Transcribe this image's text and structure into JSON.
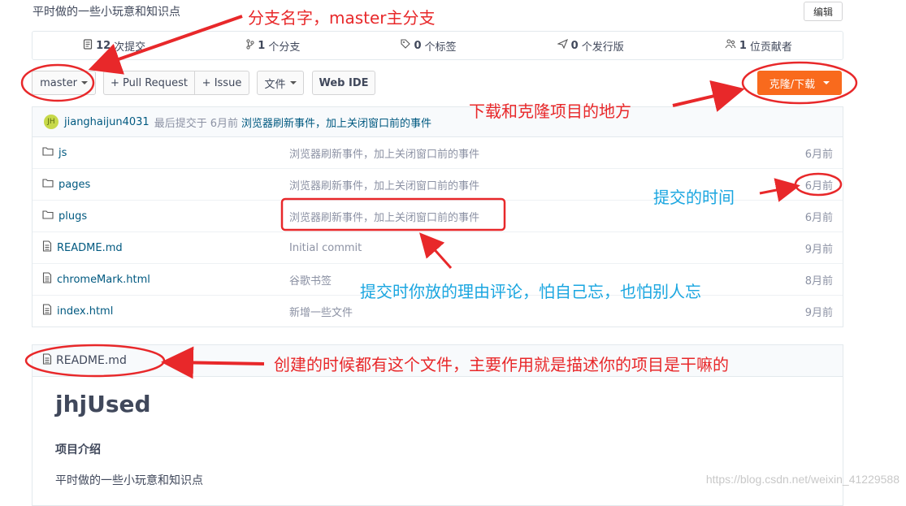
{
  "repo": {
    "description": "平时做的一些小玩意和知识点",
    "edit_label": "编辑"
  },
  "stats": [
    {
      "count": "12",
      "label": "次提交",
      "icon": "commits-icon"
    },
    {
      "count": "1",
      "label": "个分支",
      "icon": "branch-icon"
    },
    {
      "count": "0",
      "label": "个标签",
      "icon": "tag-icon"
    },
    {
      "count": "0",
      "label": "个发行版",
      "icon": "release-icon"
    },
    {
      "count": "1",
      "label": "位贡献者",
      "icon": "contributors-icon"
    }
  ],
  "toolbar": {
    "branch": "master",
    "pull_request": "+ Pull Request",
    "issue": "+ Issue",
    "file": "文件",
    "web_ide": "Web IDE",
    "clone": "克隆/下载"
  },
  "last_commit": {
    "avatar_text": "JH",
    "author": "jianghaijun4031",
    "label": "最后提交于",
    "time": "6月前",
    "message": "浏览器刷新事件，加上关闭窗口前的事件"
  },
  "files": [
    {
      "name": "js",
      "type": "folder",
      "message": "浏览器刷新事件，加上关闭窗口前的事件",
      "time": "6月前"
    },
    {
      "name": "pages",
      "type": "folder",
      "message": "浏览器刷新事件，加上关闭窗口前的事件",
      "time": "6月前"
    },
    {
      "name": "plugs",
      "type": "folder",
      "message": "浏览器刷新事件，加上关闭窗口前的事件",
      "time": "6月前"
    },
    {
      "name": "README.md",
      "type": "file",
      "message": "Initial commit",
      "time": "9月前"
    },
    {
      "name": "chromeMark.html",
      "type": "file",
      "message": "谷歌书签",
      "time": "8月前"
    },
    {
      "name": "index.html",
      "type": "file",
      "message": "新增一些文件",
      "time": "9月前"
    }
  ],
  "readme": {
    "file_name": "README.md",
    "title": "jhjUsed",
    "section": "项目介绍",
    "text": "平时做的一些小玩意和知识点"
  },
  "annotations": {
    "branch_name": "分支名字，master主分支",
    "clone_place": "下载和克隆项目的地方",
    "commit_time": "提交的时间",
    "commit_reason": "提交时你放的理由评论，怕自己忘，也怕别人忘",
    "readme_purpose": "创建的时候都有这个文件，主要作用就是描述你的项目是干嘛的"
  },
  "watermark": "https://blog.csdn.net/weixin_41229588",
  "colors": {
    "clone_button": "#f96a1d",
    "annotation_red": "#e8282a",
    "annotation_blue": "#1aa6e0",
    "link": "#005980"
  }
}
